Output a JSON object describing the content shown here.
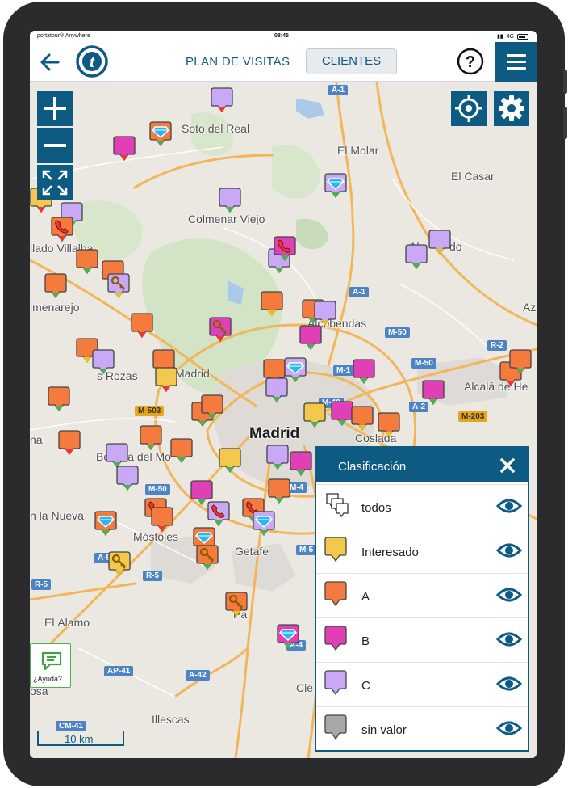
{
  "status_bar": {
    "carrier": "portatour® Anywhere",
    "time": "08:45",
    "network": "4G"
  },
  "header": {
    "back_icon": "back-arrow-icon",
    "logo_letter": "t",
    "nav_visitas": "PLAN DE VISITAS",
    "nav_clientes": "CLIENTES",
    "help_icon": "help-icon",
    "menu_icon": "hamburger-menu-icon",
    "brand_color": "#0d5a82"
  },
  "map": {
    "controls": {
      "zoom_in": "plus-icon",
      "zoom_out": "minus-icon",
      "fullscreen": "fullscreen-icon",
      "locate": "crosshair-icon",
      "settings": "gear-icon"
    },
    "places": [
      "Soto del Real",
      "El Molar",
      "El Casar",
      "Colmenar Viejo",
      "llado Villalba",
      "lmenarejo",
      "Alcobendas",
      "s Rozas",
      "Madrid",
      "Alcalá de He",
      "Madrid",
      "na",
      "Bo",
      "lla del Mo",
      "Coslada",
      "n la Nueva",
      "Móstoles",
      "Getafe",
      "El Álamo",
      "Illescas",
      "osa",
      "Pa",
      "Cie",
      "Az",
      "Al",
      "do"
    ],
    "road_labels": [
      "A-1",
      "A-1",
      "M-50",
      "M-50",
      "R-2",
      "M-1",
      "M-503",
      "A-2",
      "M-203",
      "M-40",
      "M-50",
      "M-4",
      "A-5",
      "R-5",
      "R-5",
      "M-5",
      "AP-41",
      "A-42",
      "CM-41",
      "A-4"
    ],
    "scale_label": "10 km",
    "help_label": "¿Ayuda?",
    "help_icon": "chat-icon"
  },
  "legend": {
    "title": "Clasificación",
    "close_icon": "close-icon",
    "items": [
      {
        "label": "todos",
        "color": "#ffffff",
        "icon": "all-markers-icon"
      },
      {
        "label": "Interesado",
        "color": "#f2c94c"
      },
      {
        "label": "A",
        "color": "#f47a3d"
      },
      {
        "label": "B",
        "color": "#e040b5"
      },
      {
        "label": "C",
        "color": "#c9a9f5"
      },
      {
        "label": "sin valor",
        "color": "#a8a8a8"
      }
    ],
    "visibility_icon": "eye-icon"
  },
  "pin_colors": {
    "Interesado": "#f2c94c",
    "A": "#f47a3d",
    "B": "#e040b5",
    "C": "#c9a9f5",
    "sin_valor": "#a8a8a8"
  },
  "pin_badges": {
    "diamond": "diamond-icon",
    "phone": "phone-icon",
    "key": "key-icon"
  },
  "pin_status_colors": {
    "green": "#4caf50",
    "yellow": "#e8c21a",
    "red": "#e53935"
  }
}
